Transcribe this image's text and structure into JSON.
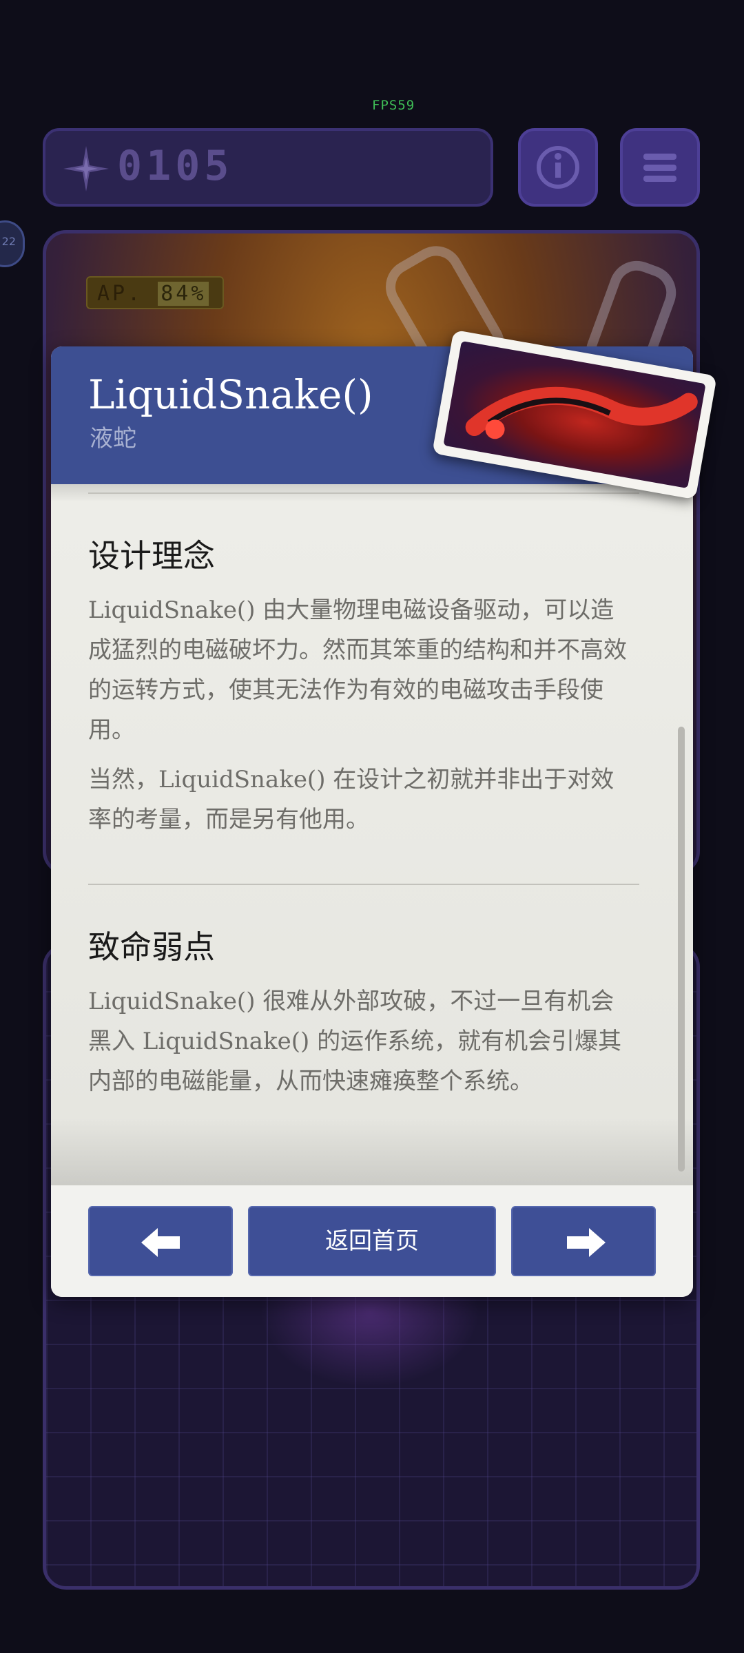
{
  "status": {
    "fps": "FPS59"
  },
  "hud": {
    "score": "0105",
    "side_badge": "22"
  },
  "ap_panel": {
    "label": "AP.",
    "value": "84%"
  },
  "dialog": {
    "title": "LiquidSnake()",
    "subtitle": "液蛇",
    "sections": [
      {
        "heading": "设计理念",
        "paragraphs": [
          "LiquidSnake() 由大量物理电磁设备驱动，可以造成猛烈的电磁破坏力。然而其笨重的结构和并不高效的运转方式，使其无法作为有效的电磁攻击手段使用。",
          "当然，LiquidSnake() 在设计之初就并非出于对效率的考量，而是另有他用。"
        ]
      },
      {
        "heading": "致命弱点",
        "paragraphs": [
          "LiquidSnake() 很难从外部攻破，不过一旦有机会黑入 LiquidSnake() 的运作系统，就有机会引爆其内部的电磁能量，从而快速瘫痪整个系统。"
        ]
      }
    ],
    "buttons": {
      "prev_icon": "arrow-left-icon",
      "home_label": "返回首页",
      "next_icon": "arrow-right-icon"
    }
  },
  "colors": {
    "header": "#3d4f92",
    "button": "#3e4f96",
    "hud": "#2a2350",
    "fps": "#3fbf57"
  }
}
